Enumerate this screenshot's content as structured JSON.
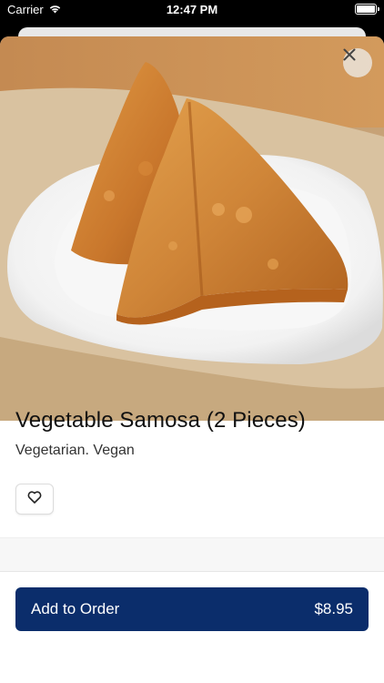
{
  "status_bar": {
    "carrier": "Carrier",
    "time": "12:47 PM"
  },
  "item": {
    "name": "Vegetable Samosa (2 Pieces)",
    "tags": "Vegetarian. Vegan"
  },
  "actions": {
    "add_label": "Add to Order",
    "price": "$8.95"
  },
  "colors": {
    "primary": "#0b2d6b"
  },
  "icons": {
    "close": "close-icon",
    "favorite": "heart-icon",
    "wifi": "wifi-icon",
    "battery": "battery-icon"
  }
}
